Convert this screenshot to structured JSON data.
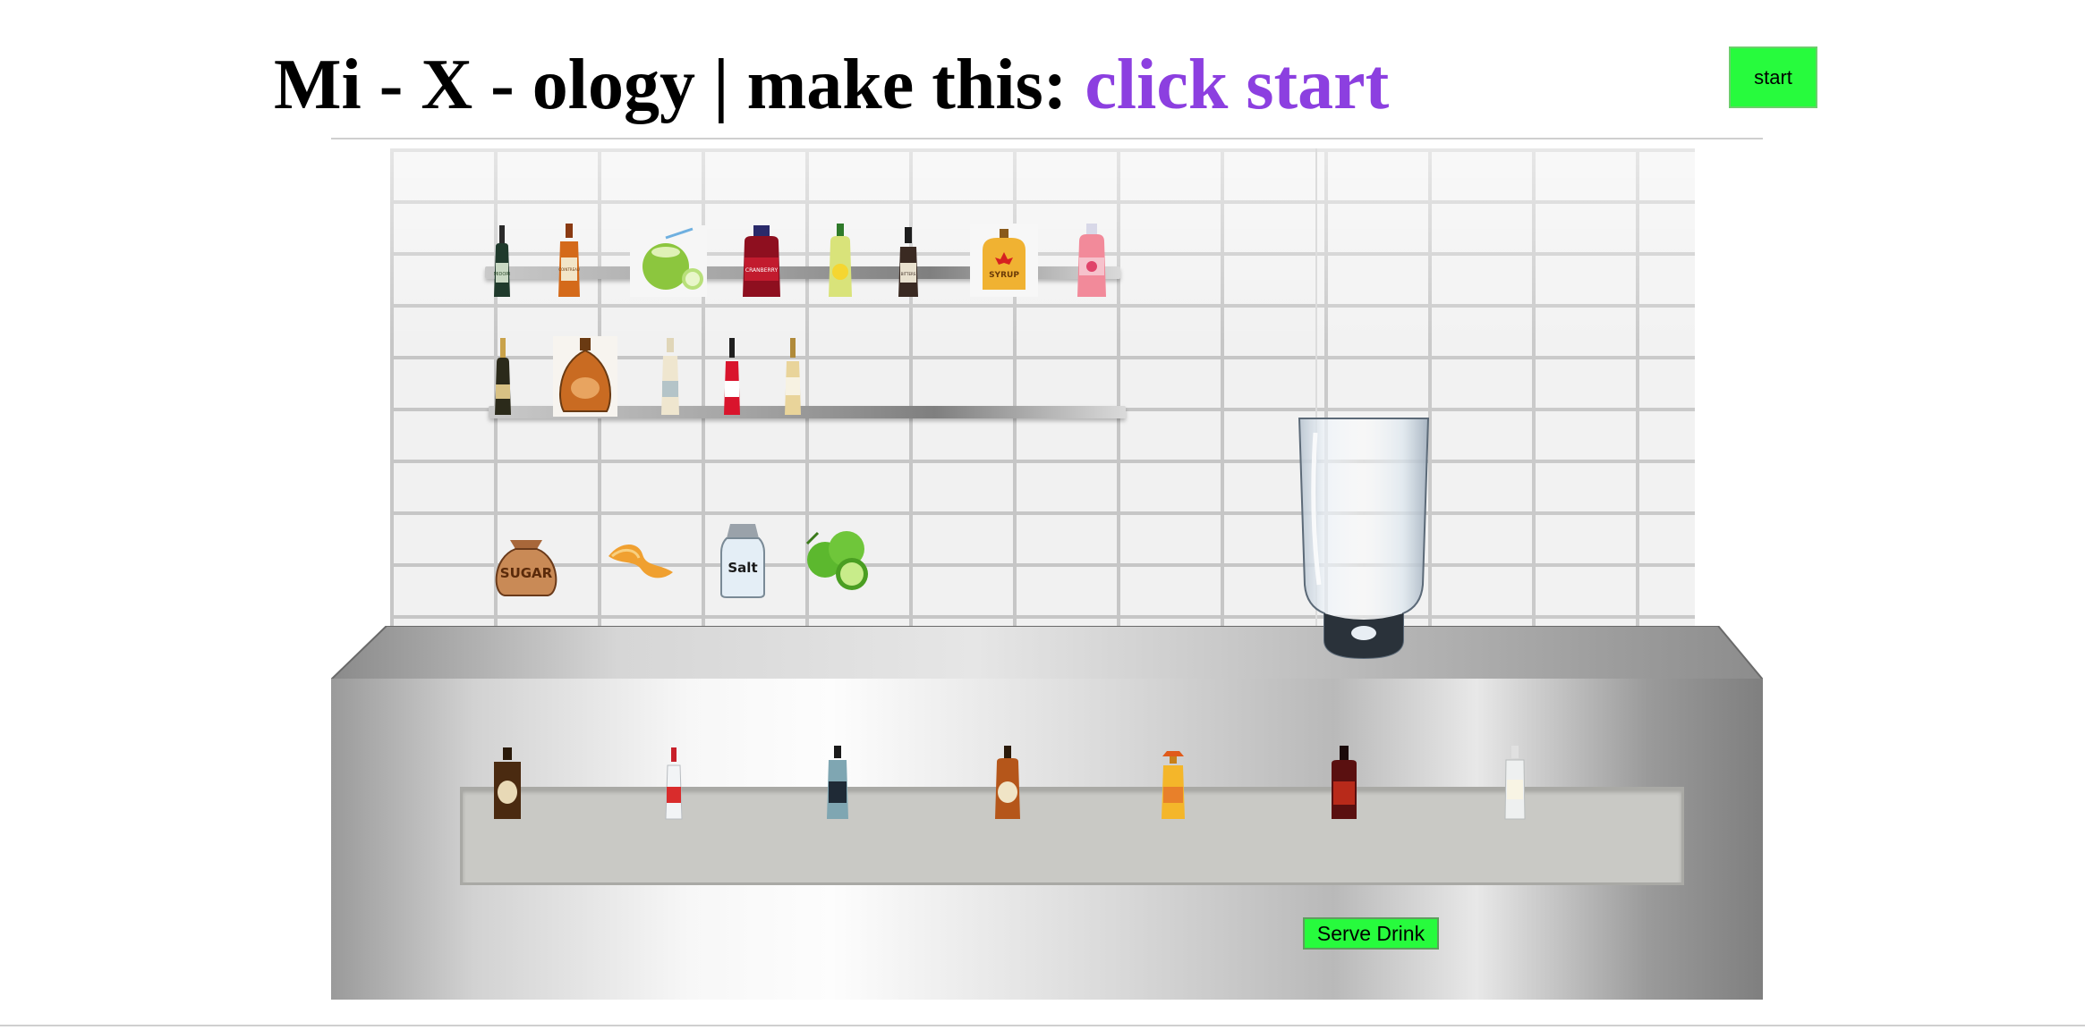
{
  "header": {
    "title_prefix": "Mi - X - ology | make this: ",
    "target_drink": "click start",
    "start_label": "start"
  },
  "actions": {
    "serve_label": "Serve Drink"
  },
  "colors": {
    "accent": "#8c3fe0",
    "button_green": "#27fb3d"
  },
  "upper_shelf": [
    {
      "name": "midori-bottle",
      "label": "MIDORI"
    },
    {
      "name": "cointreau-bottle",
      "label": "COINTREAU"
    },
    {
      "name": "coconut-drink",
      "label": ""
    },
    {
      "name": "cranberry-juice-bottle",
      "label": "CRANBERRY"
    },
    {
      "name": "lemon-juice-bottle",
      "label": ""
    },
    {
      "name": "bitters-bottle",
      "label": "BITTERS"
    },
    {
      "name": "syrup-bottle",
      "label": "SYRUP"
    },
    {
      "name": "grapefruit-juice-bottle",
      "label": ""
    }
  ],
  "lower_shelf": [
    {
      "name": "champagne-bottle",
      "label": ""
    },
    {
      "name": "cognac-bottle",
      "label": ""
    },
    {
      "name": "tonic-bottle",
      "label": ""
    },
    {
      "name": "campari-bottle",
      "label": ""
    },
    {
      "name": "vermouth-bottle",
      "label": ""
    }
  ],
  "garnishes": [
    {
      "name": "sugar-sack",
      "label": "SUGAR"
    },
    {
      "name": "orange-peel",
      "label": ""
    },
    {
      "name": "salt-shaker",
      "label": "Salt"
    },
    {
      "name": "limes",
      "label": ""
    }
  ],
  "well_bottles": [
    {
      "name": "whiskey-bottle",
      "label": ""
    },
    {
      "name": "vodka-bottle",
      "label": ""
    },
    {
      "name": "gin-bottle",
      "label": ""
    },
    {
      "name": "bourbon-bottle",
      "label": ""
    },
    {
      "name": "tequila-bottle",
      "label": ""
    },
    {
      "name": "rum-bottle",
      "label": ""
    },
    {
      "name": "white-rum-bottle",
      "label": ""
    }
  ]
}
